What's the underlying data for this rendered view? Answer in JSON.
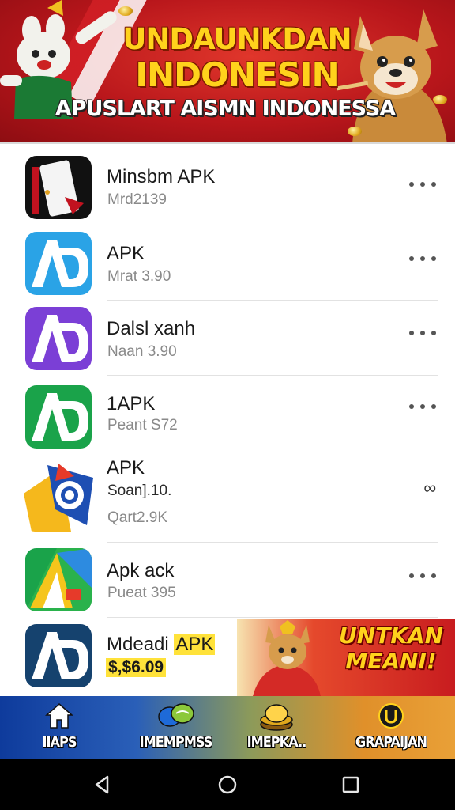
{
  "banner": {
    "title_line1": "UNDAUNKDAN",
    "title_line2": "INDONESIN",
    "subtitle": "APUSLART AISMN INDONESSA"
  },
  "apps": [
    {
      "name": "Minsbm APK",
      "meta": "Mrd2139",
      "action": "more",
      "icon": "black-red-tablet-app-icon"
    },
    {
      "name": "APK",
      "meta": "Mrat 3.90",
      "action": "more",
      "icon": "blue-ad-app-icon"
    },
    {
      "name": "Dalsl xanh",
      "meta": "Naan 3.90",
      "action": "more",
      "icon": "purple-ad-app-icon"
    },
    {
      "name": "1APK",
      "meta": "Peant S72",
      "action": "more",
      "icon": "green-ad-app-icon"
    },
    {
      "name": "APK",
      "meta": "Soan].10.",
      "meta2": "Qart2.9K",
      "action": "link",
      "action_label": "∞",
      "icon": "yellow-blue-o-app-icon"
    },
    {
      "name": "Apk ack",
      "meta": "Pueat 395",
      "action": "more",
      "icon": "green-yellow-triangle-app-icon"
    },
    {
      "name_prefix": "Mdeadi",
      "name_suffix": "APK",
      "meta": "$,$6.09",
      "icon": "navy-ad-app-icon"
    }
  ],
  "promo": {
    "line1": "UNTKAN",
    "line2": "MEANI!"
  },
  "bottom_nav": [
    {
      "label": "IIAPS",
      "icon": "home-icon"
    },
    {
      "label": "IMEMPMSS",
      "icon": "chat-bubbles-icon"
    },
    {
      "label": "IMEPKA..",
      "icon": "coin-stack-icon"
    },
    {
      "label": "GRAPAIJAN",
      "icon": "u-badge-icon"
    }
  ],
  "system_nav": [
    "back-icon",
    "home-circle-icon",
    "recents-icon"
  ],
  "colors": {
    "banner_red": "#b8161b",
    "title_yellow": "#ffd21c",
    "nav_blue": "#0e3b9c",
    "nav_orange": "#e9a037"
  }
}
